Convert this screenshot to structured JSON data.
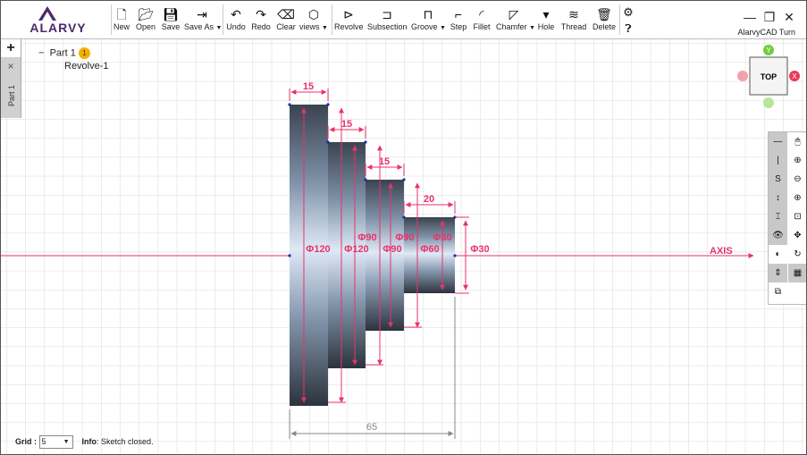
{
  "app": {
    "logo_text": "ALARVY",
    "title": "AlarvyCAD Turn"
  },
  "toolbar": {
    "new": "New",
    "open": "Open",
    "save": "Save",
    "save_as": "Save As",
    "undo": "Undo",
    "redo": "Redo",
    "clear": "Clear",
    "views": "views",
    "revolve": "Revolve",
    "subsection": "Subsection",
    "groove": "Groove",
    "step": "Step",
    "fillet": "Fillet",
    "chamfer": "Chamfer",
    "hole": "Hole",
    "thread": "Thread",
    "delete": "Delete"
  },
  "left_panel": {
    "add": "+",
    "close": "×",
    "tab": "Part 1"
  },
  "tree": {
    "part": "Part 1",
    "part_badge": "1",
    "feature": "Revolve-1",
    "collapse": "−"
  },
  "viewcube": {
    "face": "TOP",
    "y": "Y",
    "x": "X"
  },
  "drawing": {
    "axis_label": "AXIS",
    "widths": [
      "15",
      "15",
      "15",
      "20"
    ],
    "total_length": "65",
    "diameters": [
      "Φ120",
      "Φ120",
      "Φ90",
      "Φ90",
      "Φ90",
      "Φ60",
      "Φ30",
      "Φ30"
    ]
  },
  "status": {
    "grid_label": "Grid :",
    "grid_value": "5",
    "info_label": "Info",
    "info_text": ": Sketch closed."
  },
  "colors": {
    "dim": "#e8336a",
    "axis": "#e8336a",
    "grid": "#cfcfcf",
    "badge": "#f4b000"
  }
}
